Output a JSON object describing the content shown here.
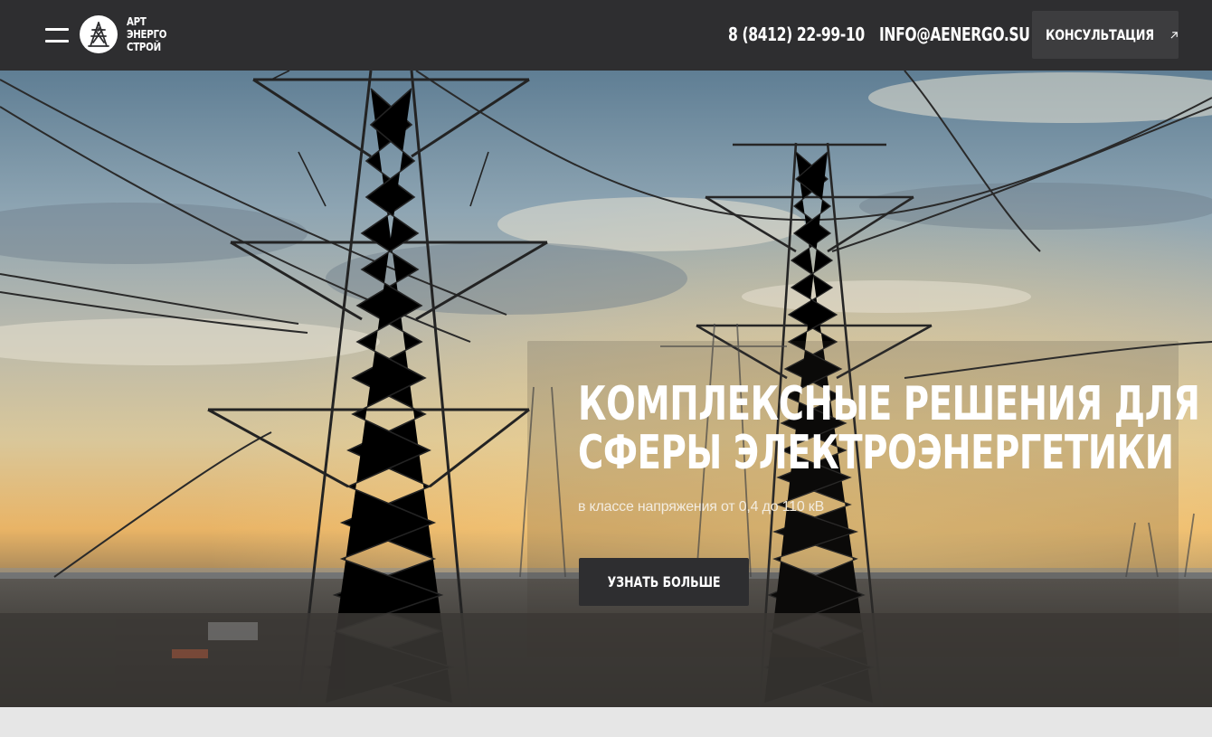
{
  "header": {
    "menu_icon": "hamburger-menu-icon",
    "logo": {
      "icon": "power-tower-logo-icon",
      "lines": [
        "АРТ",
        "ЭНЕРГО",
        "СТРОЙ"
      ]
    },
    "phone": "8 (8412) 22-99-10",
    "email": "INFO@AENERGO.SU",
    "consult_button": {
      "label": "КОНСУЛЬТАЦИЯ",
      "icon": "arrow-up-right-icon"
    }
  },
  "hero": {
    "background": "power-transmission-towers-at-sunset",
    "title_lines": [
      "КОМПЛЕКСНЫЕ РЕШЕНИЯ ДЛЯ",
      "СФЕРЫ ЭЛЕКТРОЭНЕРГЕТИКИ"
    ],
    "subtitle": "в классе напряжения от 0,4 до 110 кВ",
    "cta_label": "УЗНАТЬ БОЛЬШЕ"
  },
  "colors": {
    "header_bg": "#2e2e30",
    "button_bg": "#3d3d3f",
    "text": "#ffffff",
    "page_bg": "#e6e6e6"
  }
}
